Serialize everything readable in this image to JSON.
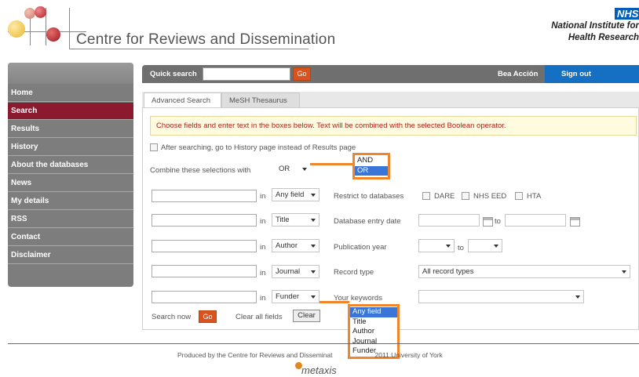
{
  "header": {
    "site_title": "Centre for Reviews and Dissemination",
    "nhs_badge": "NHS",
    "nhs_line1": "National Institute for",
    "nhs_line2": "Health Research"
  },
  "nav": {
    "items": [
      {
        "label": "Home",
        "active": false
      },
      {
        "label": "Search",
        "active": true
      },
      {
        "label": "Results",
        "active": false
      },
      {
        "label": "History",
        "active": false
      },
      {
        "label": "About the databases",
        "active": false
      },
      {
        "label": "News",
        "active": false
      },
      {
        "label": "My details",
        "active": false
      },
      {
        "label": "RSS",
        "active": false
      },
      {
        "label": "Contact",
        "active": false
      },
      {
        "label": "Disclaimer",
        "active": false
      }
    ]
  },
  "quickbar": {
    "label": "Quick search",
    "input_value": "",
    "go_label": "Go",
    "user_name": "Bea Acción",
    "signout_label": "Sign out"
  },
  "tabs": [
    {
      "label": "Advanced Search",
      "active": true
    },
    {
      "label": "MeSH Thesaurus",
      "active": false
    }
  ],
  "notice": "Choose fields and enter text in the boxes below. Text will be combined with the selected Boolean operator.",
  "history_checkbox_label": "After searching, go to History page instead of Results page",
  "combine": {
    "label": "Combine these selections with",
    "value": "OR",
    "options": [
      "AND",
      "OR"
    ]
  },
  "in_label": "in",
  "search_rows": [
    {
      "field": "Any field",
      "value": ""
    },
    {
      "field": "Title",
      "value": ""
    },
    {
      "field": "Author",
      "value": ""
    },
    {
      "field": "Journal",
      "value": ""
    },
    {
      "field": "Funder",
      "value": ""
    }
  ],
  "field_options": [
    "Any field",
    "Title",
    "Author",
    "Journal",
    "Funder"
  ],
  "restrict": {
    "label": "Restrict to databases",
    "databases": [
      "DARE",
      "NHS EED",
      "HTA"
    ]
  },
  "entry_date": {
    "label": "Database entry date",
    "to_label": "to"
  },
  "pub_year": {
    "label": "Publication year",
    "to_label": "to"
  },
  "record_type": {
    "label": "Record type",
    "value": "All record types"
  },
  "keywords": {
    "label": "Your keywords",
    "value": ""
  },
  "actions": {
    "search_now_label": "Search now",
    "go_label": "Go",
    "clear_all_label": "Clear all fields",
    "clear_label": "Clear"
  },
  "footer": {
    "text_before": "Produced by the Centre for Reviews and Disseminat",
    "text_after": "2011 University of York",
    "brand": "metaxis"
  },
  "colors": {
    "nav_active": "#8b1a2e",
    "nav_bg": "#7d7d7d",
    "signout_bg": "#1570c4",
    "go_button": "#d9531e",
    "highlight_border": "#f0852a",
    "nhs_blue": "#005eb8",
    "notice_text": "#b02020"
  }
}
